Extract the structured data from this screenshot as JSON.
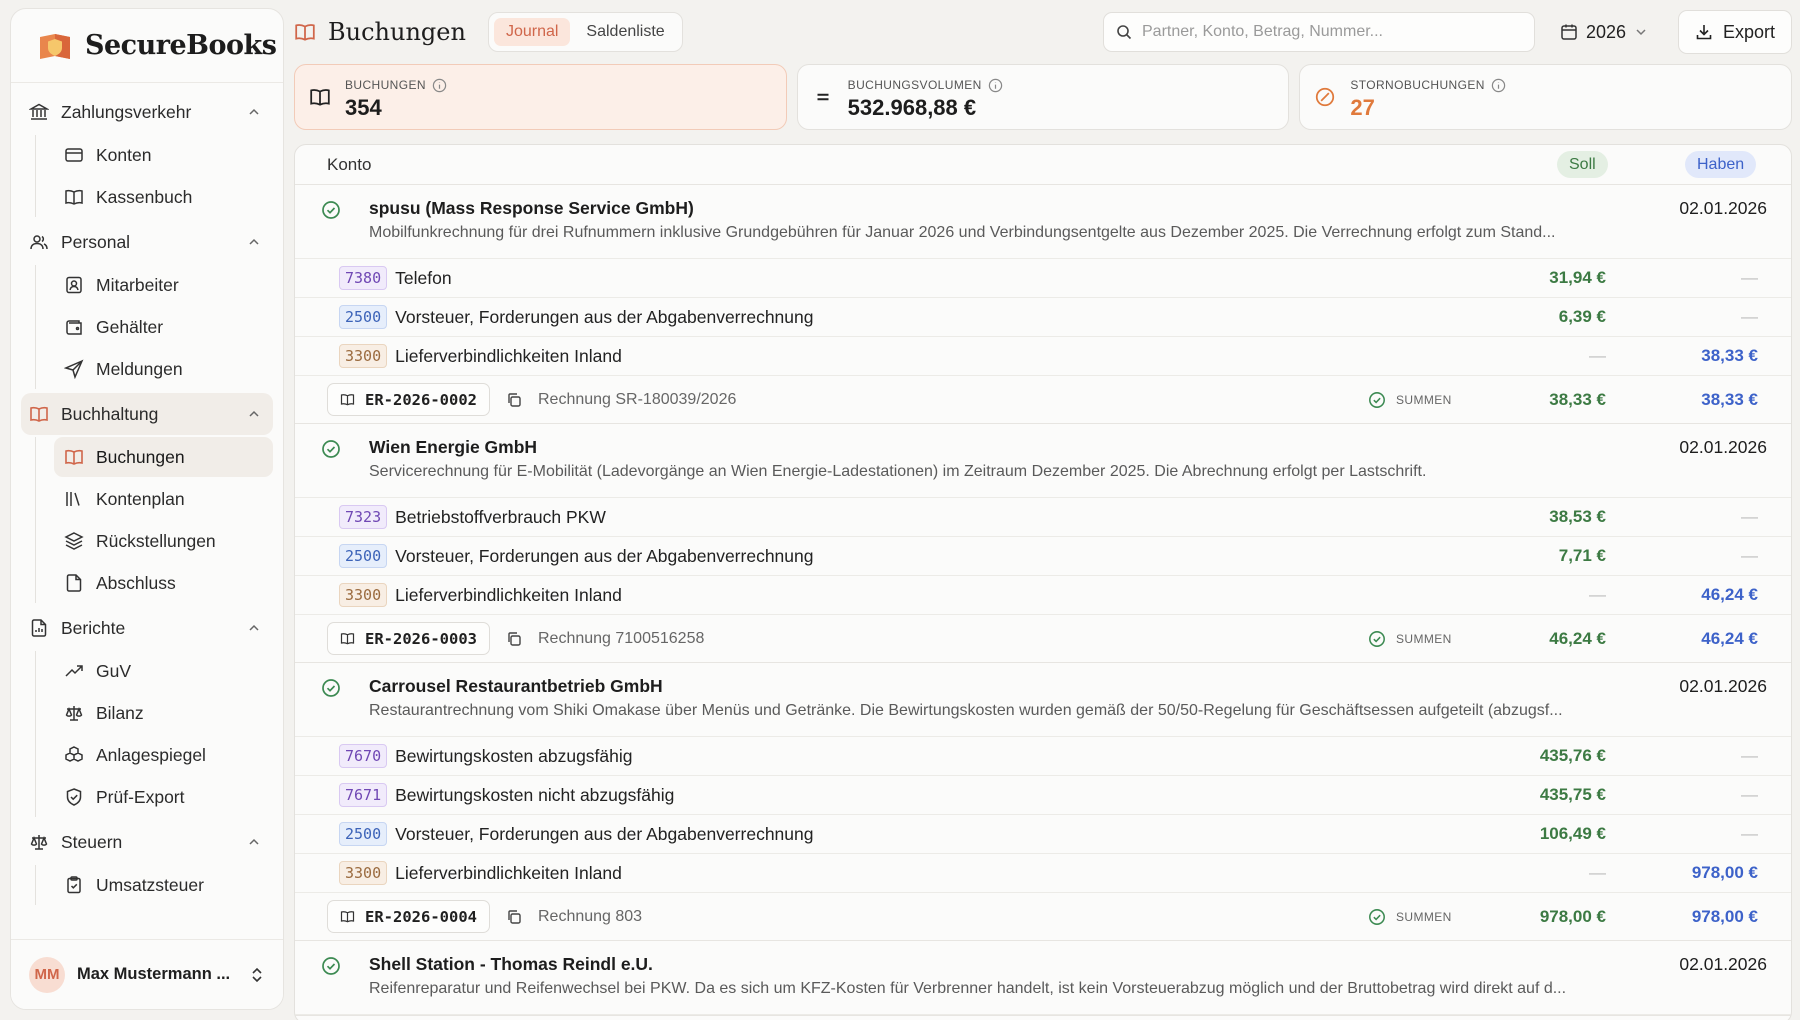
{
  "app": {
    "name": "SecureBooks"
  },
  "sidebar": {
    "groups": [
      {
        "label": "Zahlungsverkehr",
        "items": [
          {
            "label": "Konten"
          },
          {
            "label": "Kassenbuch"
          }
        ]
      },
      {
        "label": "Personal",
        "items": [
          {
            "label": "Mitarbeiter"
          },
          {
            "label": "Gehälter"
          },
          {
            "label": "Meldungen"
          }
        ]
      },
      {
        "label": "Buchhaltung",
        "items": [
          {
            "label": "Buchungen"
          },
          {
            "label": "Kontenplan"
          },
          {
            "label": "Rückstellungen"
          },
          {
            "label": "Abschluss"
          }
        ]
      },
      {
        "label": "Berichte",
        "items": [
          {
            "label": "GuV"
          },
          {
            "label": "Bilanz"
          },
          {
            "label": "Anlagespiegel"
          },
          {
            "label": "Prüf-Export"
          }
        ]
      },
      {
        "label": "Steuern",
        "items": [
          {
            "label": "Umsatzsteuer"
          }
        ]
      }
    ],
    "user": {
      "initials": "MM",
      "name": "Max Mustermann ..."
    }
  },
  "header": {
    "title": "Buchungen",
    "tabs": [
      {
        "label": "Journal"
      },
      {
        "label": "Saldenliste"
      }
    ],
    "search_placeholder": "Partner, Konto, Betrag, Nummer...",
    "year": "2026",
    "export_label": "Export"
  },
  "stats": [
    {
      "label": "BUCHUNGEN",
      "value": "354"
    },
    {
      "label": "BUCHUNGSVOLUMEN",
      "value": "532.968,88 €"
    },
    {
      "label": "STORNOBUCHUNGEN",
      "value": "27"
    }
  ],
  "journal": {
    "col_konto": "Konto",
    "col_soll": "Soll",
    "col_haben": "Haben",
    "summen_label": "SUMMEN",
    "dash": "—",
    "entries": [
      {
        "partner": "spusu (Mass Response Service GmbH)",
        "description": "Mobilfunkrechnung für drei Rufnummern inklusive Grundgebühren für Januar 2026 und Verbindungsentgelte aus Dezember 2025. Die Verrechnung erfolgt zum Stand...",
        "date": "02.01.2026",
        "lines": [
          {
            "account": "7380",
            "name": "Telefon",
            "soll": "31,94 €",
            "haben": ""
          },
          {
            "account": "2500",
            "name": "Vorsteuer, Forderungen aus der Abgabenverrechnung",
            "soll": "6,39 €",
            "haben": ""
          },
          {
            "account": "3300",
            "name": "Lieferverbindlichkeiten Inland",
            "soll": "",
            "haben": "38,33 €"
          }
        ],
        "beleg": "ER-2026-0002",
        "reference": "Rechnung SR-180039/2026",
        "sum_soll": "38,33 €",
        "sum_haben": "38,33 €"
      },
      {
        "partner": "Wien Energie GmbH",
        "description": "Servicerechnung für E-Mobilität (Ladevorgänge an Wien Energie-Ladestationen) im Zeitraum Dezember 2025. Die Abrechnung erfolgt per Lastschrift.",
        "date": "02.01.2026",
        "lines": [
          {
            "account": "7323",
            "name": "Betriebstoffverbrauch PKW",
            "soll": "38,53 €",
            "haben": ""
          },
          {
            "account": "2500",
            "name": "Vorsteuer, Forderungen aus der Abgabenverrechnung",
            "soll": "7,71 €",
            "haben": ""
          },
          {
            "account": "3300",
            "name": "Lieferverbindlichkeiten Inland",
            "soll": "",
            "haben": "46,24 €"
          }
        ],
        "beleg": "ER-2026-0003",
        "reference": "Rechnung 7100516258",
        "sum_soll": "46,24 €",
        "sum_haben": "46,24 €"
      },
      {
        "partner": "Carrousel Restaurantbetrieb GmbH",
        "description": "Restaurantrechnung vom Shiki Omakase über Menüs und Getränke. Die Bewirtungskosten wurden gemäß der 50/50-Regelung für Geschäftsessen aufgeteilt (abzugsf...",
        "date": "02.01.2026",
        "lines": [
          {
            "account": "7670",
            "name": "Bewirtungskosten abzugsfähig",
            "soll": "435,76 €",
            "haben": ""
          },
          {
            "account": "7671",
            "name": "Bewirtungskosten nicht abzugsfähig",
            "soll": "435,75 €",
            "haben": ""
          },
          {
            "account": "2500",
            "name": "Vorsteuer, Forderungen aus der Abgabenverrechnung",
            "soll": "106,49 €",
            "haben": ""
          },
          {
            "account": "3300",
            "name": "Lieferverbindlichkeiten Inland",
            "soll": "",
            "haben": "978,00 €"
          }
        ],
        "beleg": "ER-2026-0004",
        "reference": "Rechnung 803",
        "sum_soll": "978,00 €",
        "sum_haben": "978,00 €"
      },
      {
        "partner": "Shell Station - Thomas Reindl e.U.",
        "description": "Reifenreparatur und Reifenwechsel bei PKW. Da es sich um KFZ-Kosten für Verbrenner handelt, ist kein Vorsteuerabzug möglich und der Bruttobetrag wird direkt auf d...",
        "date": "02.01.2026"
      }
    ]
  },
  "colors": {
    "accent": "#d0664a",
    "soll": "#3c7a43",
    "haben": "#3d62c9",
    "storno": "#e07a3c",
    "check": "#3c8a52"
  }
}
